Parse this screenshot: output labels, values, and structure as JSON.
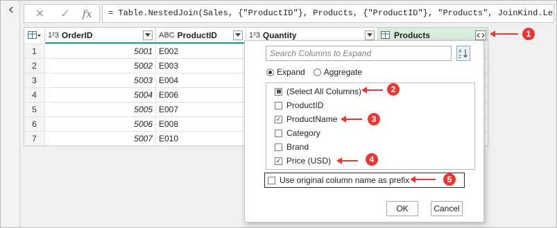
{
  "formula_bar": {
    "cancel_icon": "x-icon",
    "confirm_icon": "check-icon",
    "fx_label": "fx",
    "formula": "= Table.NestedJoin(Sales, {\"ProductID\"}, Products, {\"ProductID\"}, \"Products\", JoinKind.LeftOuter)"
  },
  "columns": [
    {
      "type_label": "1²3",
      "name": "OrderID"
    },
    {
      "type_label": "ABC",
      "name": "ProductID"
    },
    {
      "type_label": "1²3",
      "name": "Quantity"
    },
    {
      "type_label": "",
      "name": "Products"
    }
  ],
  "rows": [
    {
      "index": "1",
      "order_id": "5001",
      "product_id": "E002"
    },
    {
      "index": "2",
      "order_id": "5002",
      "product_id": "E003"
    },
    {
      "index": "3",
      "order_id": "5003",
      "product_id": "E004"
    },
    {
      "index": "4",
      "order_id": "5004",
      "product_id": "E006"
    },
    {
      "index": "5",
      "order_id": "5005",
      "product_id": "E007"
    },
    {
      "index": "6",
      "order_id": "5006",
      "product_id": "E008"
    },
    {
      "index": "7",
      "order_id": "5007",
      "product_id": "E010"
    }
  ],
  "expand_dialog": {
    "search_placeholder": "Search Columns to Expand",
    "radio_expand": "Expand",
    "radio_aggregate": "Aggregate",
    "selected_mode": "Expand",
    "items": [
      {
        "label": "(Select All Columns)",
        "state": "partial"
      },
      {
        "label": "ProductID",
        "state": "unchecked"
      },
      {
        "label": "ProductName",
        "state": "checked"
      },
      {
        "label": "Category",
        "state": "unchecked"
      },
      {
        "label": "Brand",
        "state": "unchecked"
      },
      {
        "label": "Price (USD)",
        "state": "checked"
      }
    ],
    "prefix_label": "Use original column name as prefix",
    "prefix_checked": false,
    "ok_label": "OK",
    "cancel_label": "Cancel"
  },
  "callouts": [
    "1",
    "2",
    "3",
    "4",
    "5"
  ],
  "colors": {
    "accent_teal": "#1a9f8a",
    "products_header_bg": "#d8eedd",
    "callout_red": "#e53935"
  }
}
